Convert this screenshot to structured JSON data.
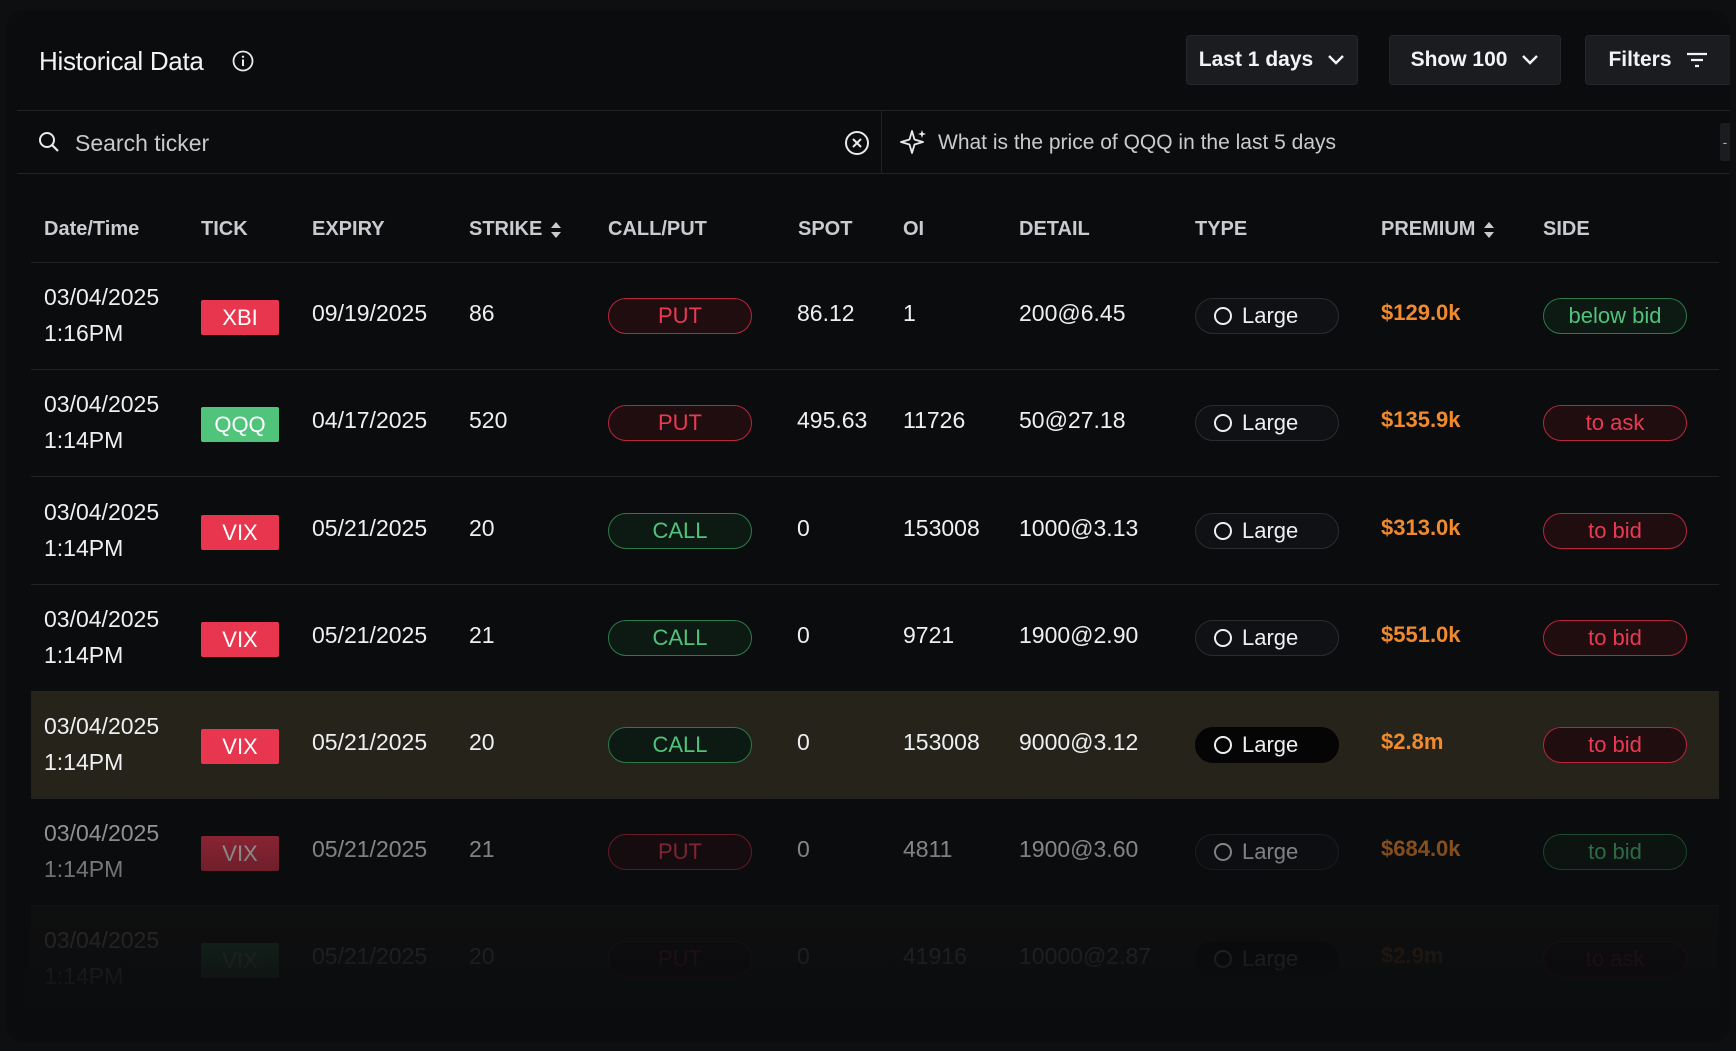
{
  "header": {
    "title": "Historical Data",
    "range_label": "Last 1 days",
    "show_label": "Show 100",
    "filters_label": "Filters"
  },
  "search": {
    "placeholder": "Search ticker",
    "ai_prompt": "What is the price of QQQ in the last 5 days"
  },
  "columns": [
    "Date/Time",
    "TICK",
    "EXPIRY",
    "STRIKE",
    "CALL/PUT",
    "SPOT",
    "OI",
    "DETAIL",
    "TYPE",
    "PREMIUM",
    "SIDE"
  ],
  "rows": [
    {
      "date": "03/04/2025",
      "time": "1:16PM",
      "tick": "XBI",
      "tick_color": "red",
      "expiry": "09/19/2025",
      "strike": "86",
      "callput": "PUT",
      "spot": "86.12",
      "oi": "1",
      "detail": "200@6.45",
      "type": "Large",
      "premium": "$129.0k",
      "side": "below bid",
      "side_color": "green"
    },
    {
      "date": "03/04/2025",
      "time": "1:14PM",
      "tick": "QQQ",
      "tick_color": "green",
      "expiry": "04/17/2025",
      "strike": "520",
      "callput": "PUT",
      "spot": "495.63",
      "oi": "11726",
      "detail": "50@27.18",
      "type": "Large",
      "premium": "$135.9k",
      "side": "to ask",
      "side_color": "red"
    },
    {
      "date": "03/04/2025",
      "time": "1:14PM",
      "tick": "VIX",
      "tick_color": "red",
      "expiry": "05/21/2025",
      "strike": "20",
      "callput": "CALL",
      "spot": "0",
      "oi": "153008",
      "detail": "1000@3.13",
      "type": "Large",
      "premium": "$313.0k",
      "side": "to bid",
      "side_color": "red"
    },
    {
      "date": "03/04/2025",
      "time": "1:14PM",
      "tick": "VIX",
      "tick_color": "red",
      "expiry": "05/21/2025",
      "strike": "21",
      "callput": "CALL",
      "spot": "0",
      "oi": "9721",
      "detail": "1900@2.90",
      "type": "Large",
      "premium": "$551.0k",
      "side": "to bid",
      "side_color": "red"
    },
    {
      "date": "03/04/2025",
      "time": "1:14PM",
      "tick": "VIX",
      "tick_color": "red",
      "expiry": "05/21/2025",
      "strike": "20",
      "callput": "CALL",
      "spot": "0",
      "oi": "153008",
      "detail": "9000@3.12",
      "type": "Large",
      "premium": "$2.8m",
      "side": "to bid",
      "side_color": "red",
      "highlight": true
    },
    {
      "date": "03/04/2025",
      "time": "1:14PM",
      "tick": "VIX",
      "tick_color": "red",
      "expiry": "05/21/2025",
      "strike": "21",
      "callput": "PUT",
      "spot": "0",
      "oi": "4811",
      "detail": "1900@3.60",
      "type": "Large",
      "premium": "$684.0k",
      "side": "to bid",
      "side_color": "green"
    },
    {
      "date": "03/04/2025",
      "time": "1:14PM",
      "tick": "VIX",
      "tick_color": "green",
      "expiry": "05/21/2025",
      "strike": "20",
      "callput": "PUT",
      "spot": "0",
      "oi": "41916",
      "detail": "10000@2.87",
      "type": "Large",
      "premium": "$2.9m",
      "side": "to ask",
      "side_color": "red",
      "highlight": true
    }
  ]
}
